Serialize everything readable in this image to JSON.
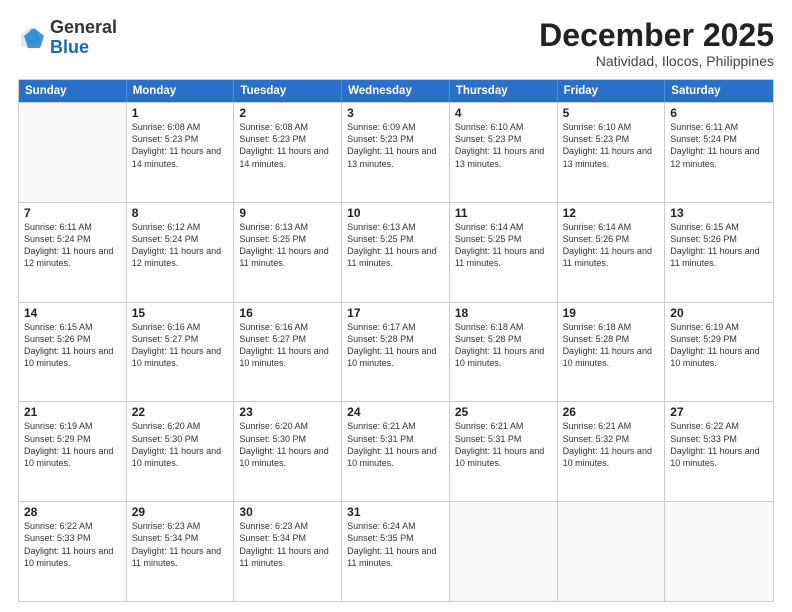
{
  "logo": {
    "general": "General",
    "blue": "Blue"
  },
  "header": {
    "month": "December 2025",
    "location": "Natividad, Ilocos, Philippines"
  },
  "weekdays": [
    "Sunday",
    "Monday",
    "Tuesday",
    "Wednesday",
    "Thursday",
    "Friday",
    "Saturday"
  ],
  "weeks": [
    [
      {
        "day": null
      },
      {
        "day": "1",
        "sunrise": "6:08 AM",
        "sunset": "5:23 PM",
        "daylight": "11 hours and 14 minutes."
      },
      {
        "day": "2",
        "sunrise": "6:08 AM",
        "sunset": "5:23 PM",
        "daylight": "11 hours and 14 minutes."
      },
      {
        "day": "3",
        "sunrise": "6:09 AM",
        "sunset": "5:23 PM",
        "daylight": "11 hours and 13 minutes."
      },
      {
        "day": "4",
        "sunrise": "6:10 AM",
        "sunset": "5:23 PM",
        "daylight": "11 hours and 13 minutes."
      },
      {
        "day": "5",
        "sunrise": "6:10 AM",
        "sunset": "5:23 PM",
        "daylight": "11 hours and 13 minutes."
      },
      {
        "day": "6",
        "sunrise": "6:11 AM",
        "sunset": "5:24 PM",
        "daylight": "11 hours and 12 minutes."
      }
    ],
    [
      {
        "day": "7",
        "sunrise": "6:11 AM",
        "sunset": "5:24 PM",
        "daylight": "11 hours and 12 minutes."
      },
      {
        "day": "8",
        "sunrise": "6:12 AM",
        "sunset": "5:24 PM",
        "daylight": "11 hours and 12 minutes."
      },
      {
        "day": "9",
        "sunrise": "6:13 AM",
        "sunset": "5:25 PM",
        "daylight": "11 hours and 11 minutes."
      },
      {
        "day": "10",
        "sunrise": "6:13 AM",
        "sunset": "5:25 PM",
        "daylight": "11 hours and 11 minutes."
      },
      {
        "day": "11",
        "sunrise": "6:14 AM",
        "sunset": "5:25 PM",
        "daylight": "11 hours and 11 minutes."
      },
      {
        "day": "12",
        "sunrise": "6:14 AM",
        "sunset": "5:26 PM",
        "daylight": "11 hours and 11 minutes."
      },
      {
        "day": "13",
        "sunrise": "6:15 AM",
        "sunset": "5:26 PM",
        "daylight": "11 hours and 11 minutes."
      }
    ],
    [
      {
        "day": "14",
        "sunrise": "6:15 AM",
        "sunset": "5:26 PM",
        "daylight": "11 hours and 10 minutes."
      },
      {
        "day": "15",
        "sunrise": "6:16 AM",
        "sunset": "5:27 PM",
        "daylight": "11 hours and 10 minutes."
      },
      {
        "day": "16",
        "sunrise": "6:16 AM",
        "sunset": "5:27 PM",
        "daylight": "11 hours and 10 minutes."
      },
      {
        "day": "17",
        "sunrise": "6:17 AM",
        "sunset": "5:28 PM",
        "daylight": "11 hours and 10 minutes."
      },
      {
        "day": "18",
        "sunrise": "6:18 AM",
        "sunset": "5:28 PM",
        "daylight": "11 hours and 10 minutes."
      },
      {
        "day": "19",
        "sunrise": "6:18 AM",
        "sunset": "5:28 PM",
        "daylight": "11 hours and 10 minutes."
      },
      {
        "day": "20",
        "sunrise": "6:19 AM",
        "sunset": "5:29 PM",
        "daylight": "11 hours and 10 minutes."
      }
    ],
    [
      {
        "day": "21",
        "sunrise": "6:19 AM",
        "sunset": "5:29 PM",
        "daylight": "11 hours and 10 minutes."
      },
      {
        "day": "22",
        "sunrise": "6:20 AM",
        "sunset": "5:30 PM",
        "daylight": "11 hours and 10 minutes."
      },
      {
        "day": "23",
        "sunrise": "6:20 AM",
        "sunset": "5:30 PM",
        "daylight": "11 hours and 10 minutes."
      },
      {
        "day": "24",
        "sunrise": "6:21 AM",
        "sunset": "5:31 PM",
        "daylight": "11 hours and 10 minutes."
      },
      {
        "day": "25",
        "sunrise": "6:21 AM",
        "sunset": "5:31 PM",
        "daylight": "11 hours and 10 minutes."
      },
      {
        "day": "26",
        "sunrise": "6:21 AM",
        "sunset": "5:32 PM",
        "daylight": "11 hours and 10 minutes."
      },
      {
        "day": "27",
        "sunrise": "6:22 AM",
        "sunset": "5:33 PM",
        "daylight": "11 hours and 10 minutes."
      }
    ],
    [
      {
        "day": "28",
        "sunrise": "6:22 AM",
        "sunset": "5:33 PM",
        "daylight": "11 hours and 10 minutes."
      },
      {
        "day": "29",
        "sunrise": "6:23 AM",
        "sunset": "5:34 PM",
        "daylight": "11 hours and 11 minutes."
      },
      {
        "day": "30",
        "sunrise": "6:23 AM",
        "sunset": "5:34 PM",
        "daylight": "11 hours and 11 minutes."
      },
      {
        "day": "31",
        "sunrise": "6:24 AM",
        "sunset": "5:35 PM",
        "daylight": "11 hours and 11 minutes."
      },
      {
        "day": null
      },
      {
        "day": null
      },
      {
        "day": null
      }
    ]
  ]
}
